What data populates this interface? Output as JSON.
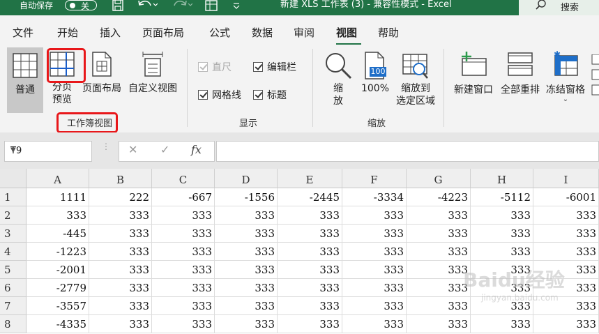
{
  "titlebar": {
    "autosave_label": "自动保存",
    "autosave_state": "关",
    "document_title": "新建 XLS 工作表 (3)  -  兼容性模式  -  Excel",
    "search_label": "搜索"
  },
  "tabs": [
    {
      "label": "文件"
    },
    {
      "label": "开始"
    },
    {
      "label": "插入"
    },
    {
      "label": "页面布局"
    },
    {
      "label": "公式"
    },
    {
      "label": "数据"
    },
    {
      "label": "审阅"
    },
    {
      "label": "视图"
    },
    {
      "label": "帮助"
    }
  ],
  "active_tab": "视图",
  "ribbon": {
    "workbook_views": {
      "group_label": "工作簿视图",
      "normal": "普通",
      "page_break_line1": "分页",
      "page_break_line2": "预览",
      "page_layout": "页面布局",
      "custom_views": "自定义视图"
    },
    "show": {
      "group_label": "显示",
      "ruler": "直尺",
      "formula_bar": "编辑栏",
      "gridlines": "网格线",
      "headings": "标题"
    },
    "zoom": {
      "group_label": "缩放",
      "zoom_line1": "缩",
      "zoom_line2": "放",
      "zoom_100": "100%",
      "zoom_100_badge": "100",
      "zoom_selection_line1": "缩放到",
      "zoom_selection_line2": "选定区域"
    },
    "window": {
      "new_window": "新建窗口",
      "arrange_all": "全部重排",
      "freeze_panes": "冻结窗格"
    }
  },
  "formula_bar": {
    "name_box": "T9",
    "fx": "fx",
    "value": ""
  },
  "sheet": {
    "columns": [
      "A",
      "B",
      "C",
      "D",
      "E",
      "F",
      "G",
      "H",
      "I"
    ],
    "rows": [
      {
        "num": "1",
        "cells": [
          "1111",
          "222",
          "-667",
          "-1556",
          "-2445",
          "-3334",
          "-4223",
          "-5112",
          "-6001"
        ]
      },
      {
        "num": "2",
        "cells": [
          "333",
          "333",
          "333",
          "333",
          "333",
          "333",
          "333",
          "333",
          "333"
        ]
      },
      {
        "num": "3",
        "cells": [
          "-445",
          "333",
          "333",
          "333",
          "333",
          "333",
          "333",
          "333",
          "333"
        ]
      },
      {
        "num": "4",
        "cells": [
          "-1223",
          "333",
          "333",
          "333",
          "333",
          "333",
          "333",
          "333",
          "333"
        ]
      },
      {
        "num": "5",
        "cells": [
          "-2001",
          "333",
          "333",
          "333",
          "333",
          "333",
          "333",
          "333",
          "333"
        ]
      },
      {
        "num": "6",
        "cells": [
          "-2779",
          "333",
          "333",
          "333",
          "333",
          "333",
          "333",
          "333",
          "333"
        ]
      },
      {
        "num": "7",
        "cells": [
          "-3557",
          "333",
          "333",
          "333",
          "333",
          "333",
          "333",
          "333",
          "333"
        ]
      },
      {
        "num": "8",
        "cells": [
          "-4335",
          "333",
          "333",
          "333",
          "333",
          "333",
          "333",
          "333",
          "333"
        ]
      }
    ]
  },
  "watermark": {
    "logo": "Baidu经验",
    "url": "jingyan.baidu.com"
  },
  "colors": {
    "excel_green": "#217346",
    "highlight_red": "#e8171a"
  }
}
